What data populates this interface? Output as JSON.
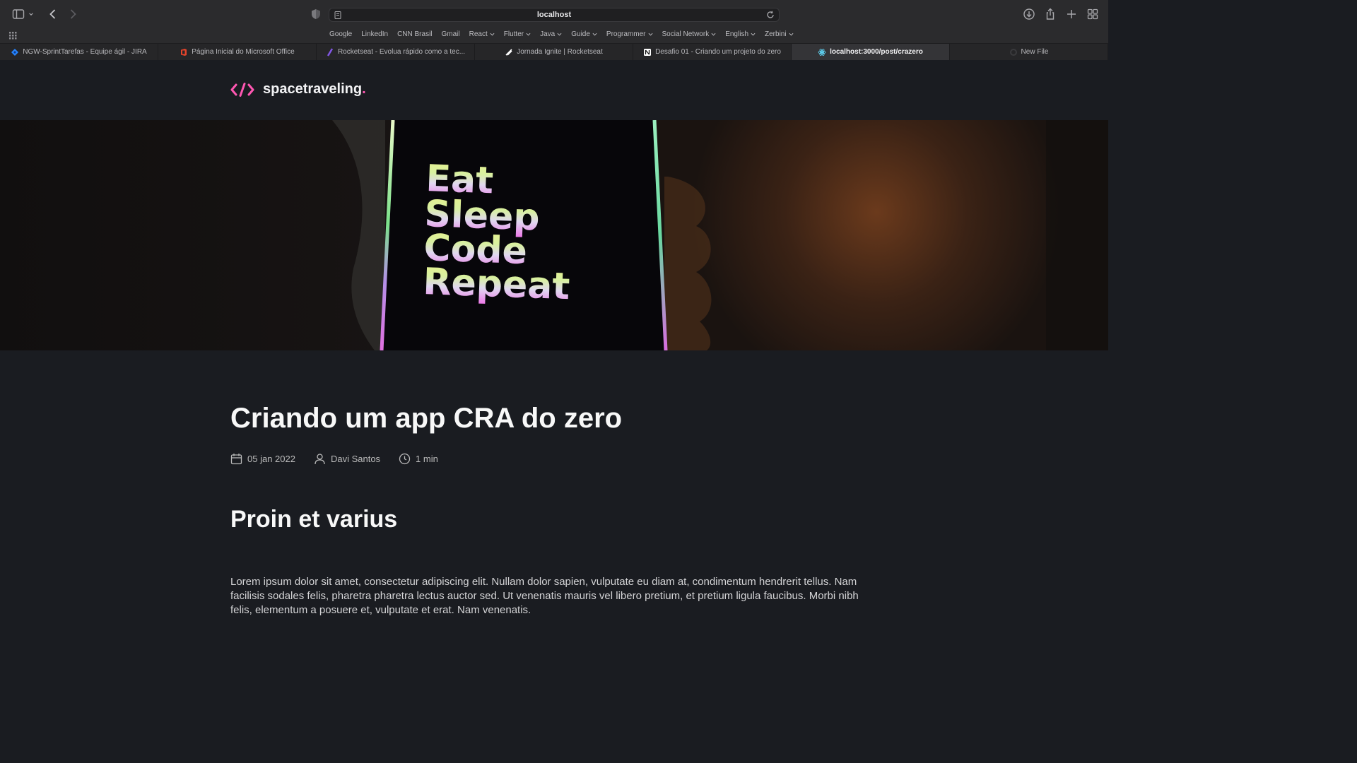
{
  "browser": {
    "url": "localhost",
    "bookmarks": [
      {
        "label": "Google",
        "dropdown": false
      },
      {
        "label": "LinkedIn",
        "dropdown": false
      },
      {
        "label": "CNN Brasil",
        "dropdown": false
      },
      {
        "label": "Gmail",
        "dropdown": false
      },
      {
        "label": "React",
        "dropdown": true
      },
      {
        "label": "Flutter",
        "dropdown": true
      },
      {
        "label": "Java",
        "dropdown": true
      },
      {
        "label": "Guide",
        "dropdown": true
      },
      {
        "label": "Programmer",
        "dropdown": true
      },
      {
        "label": "Social Network",
        "dropdown": true
      },
      {
        "label": "English",
        "dropdown": true
      },
      {
        "label": "Zerbini",
        "dropdown": true
      }
    ],
    "tabs": [
      {
        "label": "NGW-SprintTarefas - Equipe ágil - JIRA",
        "icon": "jira-icon",
        "active": false
      },
      {
        "label": "Página Inicial do Microsoft Office",
        "icon": "office-icon",
        "active": false
      },
      {
        "label": "Rocketseat - Evolua rápido como a tec...",
        "icon": "rocketseat-icon",
        "active": false
      },
      {
        "label": "Jornada Ignite | Rocketseat",
        "icon": "rocket-icon",
        "active": false
      },
      {
        "label": "Desafio 01 - Criando um projeto do zero",
        "icon": "notion-icon",
        "active": false
      },
      {
        "label": "localhost:3000/post/crazero",
        "icon": "react-icon",
        "active": true
      },
      {
        "label": "New File",
        "icon": "github-icon",
        "active": false
      }
    ]
  },
  "site": {
    "logo_text": "spacetraveling",
    "logo_dot": ".",
    "accent_color": "#ff57b2"
  },
  "banner": {
    "words": [
      "Eat",
      "Sleep",
      "Code",
      "Repeat"
    ]
  },
  "post": {
    "title": "Criando um app CRA do zero",
    "date": "05 jan 2022",
    "author": "Davi Santos",
    "reading_time": "1 min",
    "heading": "Proin et varius",
    "paragraph": "Lorem ipsum dolor sit amet, consectetur adipiscing elit. Nullam dolor sapien, vulputate eu diam at, condimentum hendrerit tellus. Nam facilisis sodales felis, pharetra pharetra lectus auctor sed. Ut venenatis mauris vel libero pretium, et pretium ligula faucibus. Morbi nibh felis, elementum a posuere et, vulputate et erat. Nam venenatis."
  }
}
